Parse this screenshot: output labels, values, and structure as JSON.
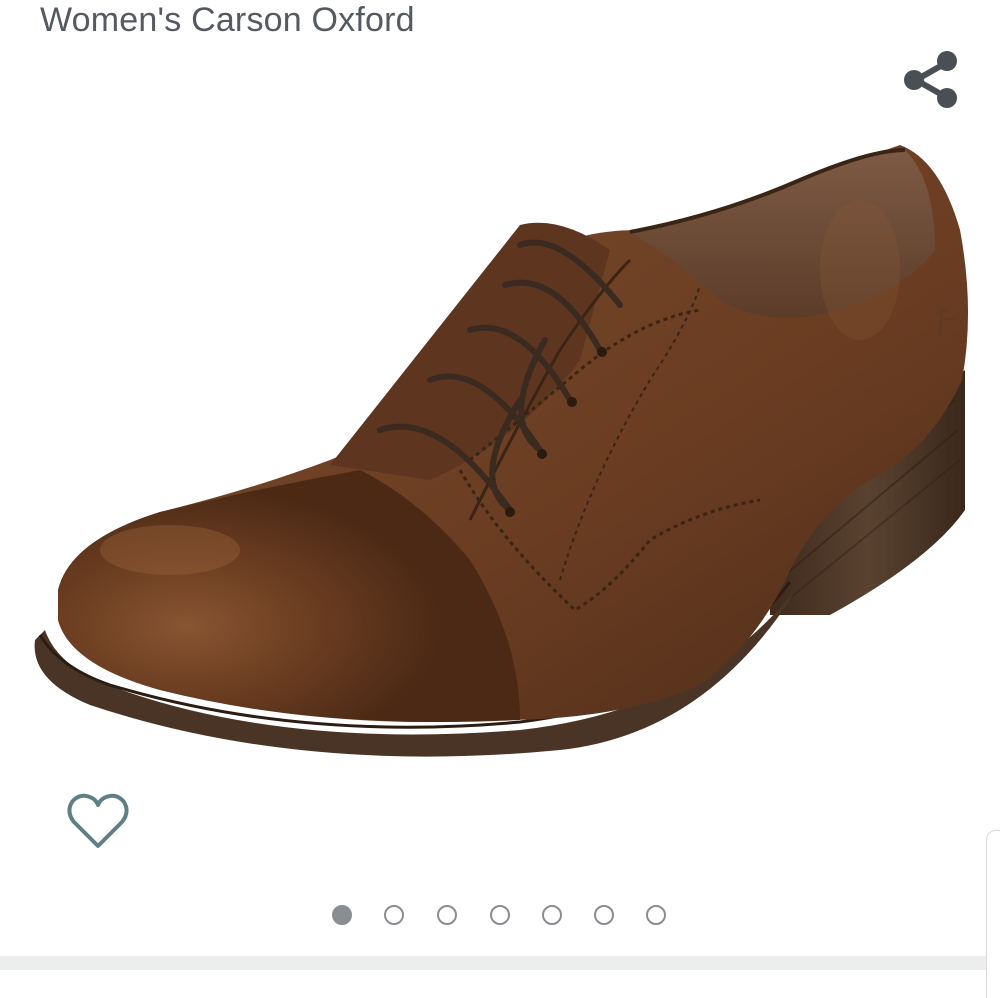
{
  "product": {
    "title": "Women's Carson Oxford"
  },
  "actions": {
    "share_icon": "share-icon",
    "wishlist_icon": "heart-outline-icon"
  },
  "gallery": {
    "image_subject": "brown leather lace-up oxford shoe",
    "image_count": 7,
    "active_index": 1
  },
  "colors": {
    "title_text": "#555a60",
    "icon_gray": "#4a4f55",
    "heart_teal": "#5f7f86",
    "dot_gray": "#8a8d91",
    "leather_brown": "#6b3f24"
  }
}
